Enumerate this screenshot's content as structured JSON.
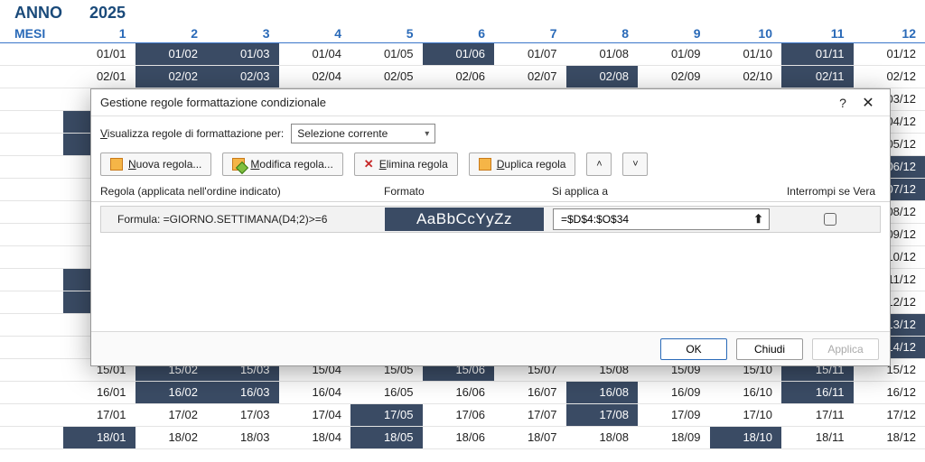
{
  "sheet": {
    "year_label": "ANNO",
    "year_value": "2025",
    "months_label": "MESI",
    "months": [
      "1",
      "2",
      "3",
      "4",
      "5",
      "6",
      "7",
      "8",
      "9",
      "10",
      "11",
      "12"
    ],
    "weekend_map": {
      "1": [
        4,
        5,
        11,
        12,
        18,
        19,
        25,
        26
      ],
      "2": [
        1,
        2,
        8,
        9,
        15,
        16,
        22,
        23
      ],
      "3": [
        1,
        2,
        8,
        9,
        15,
        16,
        22,
        23,
        29,
        30
      ],
      "4": [
        5,
        6,
        12,
        13,
        19,
        20,
        26,
        27
      ],
      "5": [
        3,
        4,
        10,
        11,
        17,
        18,
        24,
        25,
        31
      ],
      "6": [
        1,
        7,
        8,
        14,
        15,
        21,
        22,
        28,
        29
      ],
      "7": [
        5,
        6,
        12,
        13,
        19,
        20,
        26,
        27
      ],
      "8": [
        2,
        3,
        9,
        10,
        16,
        17,
        23,
        24,
        30,
        31
      ],
      "9": [
        6,
        7,
        13,
        14,
        20,
        21,
        27,
        28
      ],
      "10": [
        4,
        5,
        11,
        12,
        18,
        19,
        25,
        26
      ],
      "11": [
        1,
        2,
        8,
        9,
        15,
        16,
        22,
        23,
        29,
        30
      ],
      "12": [
        6,
        7,
        13,
        14,
        20,
        21,
        27,
        28
      ]
    },
    "visible_rows": [
      1,
      2,
      3,
      4,
      5,
      6,
      7,
      8,
      9,
      10,
      11,
      12,
      13,
      14,
      15,
      16,
      17,
      18
    ]
  },
  "dialog": {
    "title": "Gestione regole formattazione condizionale",
    "help": "?",
    "close": "✕",
    "filter_label_pre": "V",
    "filter_label_rest": "isualizza regole di formattazione per:",
    "filter_value": "Selezione corrente",
    "toolbar": {
      "nuova_pre": "N",
      "nuova_rest": "uova regola...",
      "modifica_pre": "M",
      "modifica_rest": "odifica regola...",
      "elimina_pre": "E",
      "elimina_rest": "limina regola",
      "duplica_pre": "D",
      "duplica_rest": "uplica regola",
      "up": "˄",
      "down": "˅"
    },
    "headers": {
      "rule": "Regola (applicata nell'ordine indicato)",
      "format": "Formato",
      "applies": "Si applica a",
      "stop": "Interrompi se Vera"
    },
    "rule": {
      "formula_label": "Formula: =GIORNO.SETTIMANA(D4;2)>=6",
      "preview": "AaBbCcYyZz",
      "applies_to": "=$D$4:$O$34",
      "range_icon": "⬆"
    },
    "footer": {
      "ok": "OK",
      "close": "Chiudi",
      "apply": "Applica"
    }
  }
}
